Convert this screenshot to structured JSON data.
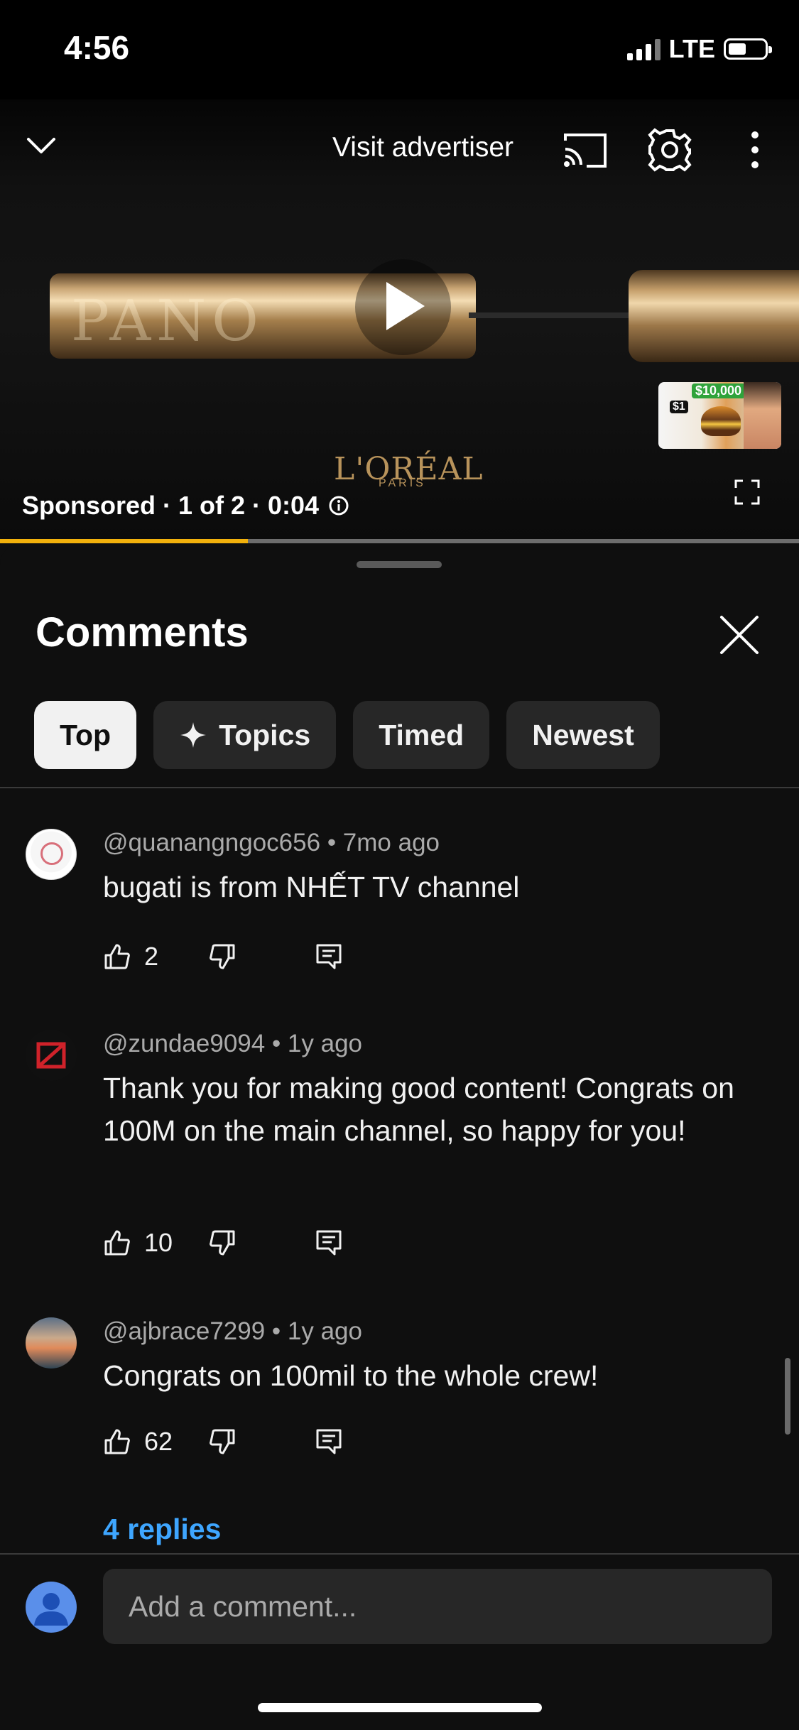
{
  "status_bar": {
    "time": "4:56",
    "network": "LTE"
  },
  "player": {
    "visit_advertiser": "Visit advertiser",
    "brand": "L'ORÉAL",
    "brand_sub": "PARIS",
    "product_text": "PANO",
    "sponsored": "Sponsored · 1 of 2 · 0:04",
    "progress": 0.31,
    "thumbnail": {
      "amount": "$10,000",
      "small_amount": "$1"
    }
  },
  "comments": {
    "title": "Comments",
    "chips": [
      "Top",
      "Topics",
      "Timed",
      "Newest"
    ],
    "items": [
      {
        "author": "@quanangngoc656",
        "age": "7mo ago",
        "text": "bugati is from NHẾT TV channel",
        "likes": "2"
      },
      {
        "author": "@zundae9094",
        "age": "1y ago",
        "text": "Thank you for making good content! Congrats on 100M on the main channel, so happy for you!",
        "likes": "10"
      },
      {
        "author": "@ajbrace7299",
        "age": "1y ago",
        "text": "Congrats on 100mil to the whole crew!",
        "likes": "62"
      }
    ],
    "replies_link": "4 replies",
    "add_comment_placeholder": "Add a comment..."
  },
  "colors": {
    "accent_progress": "#f2b10c",
    "link": "#3ea6ff",
    "background": "#0f0f0f"
  }
}
